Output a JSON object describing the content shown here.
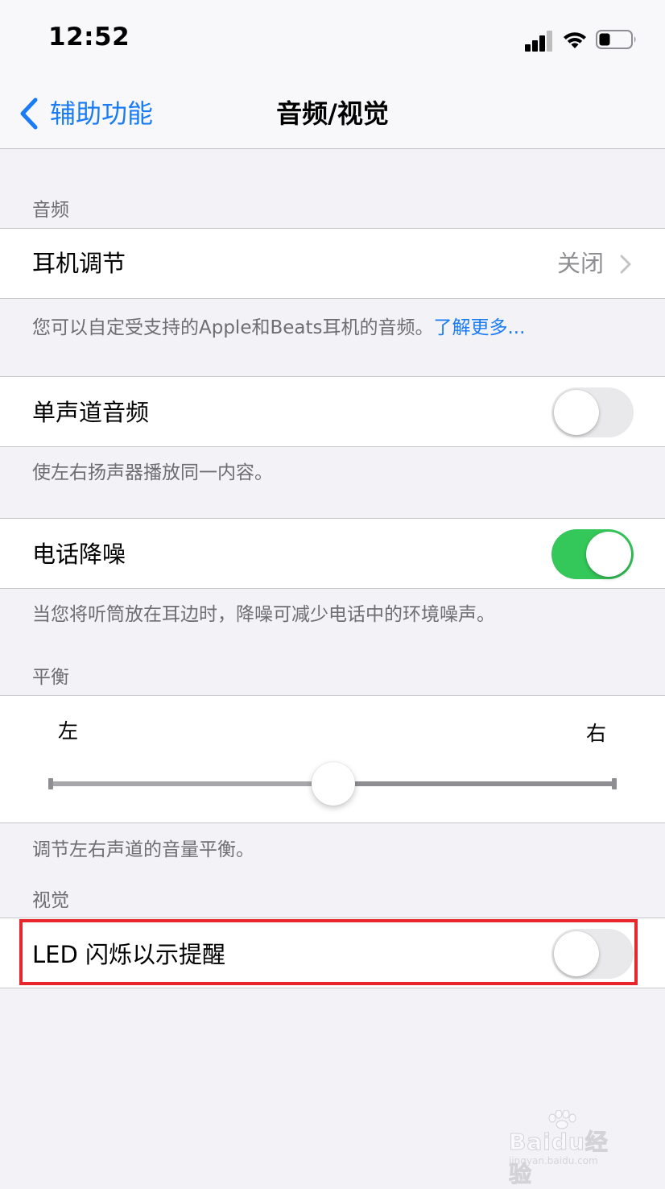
{
  "status_bar": {
    "time": "12:52"
  },
  "nav": {
    "back_label": "辅助功能",
    "title": "音频/视觉"
  },
  "audio_section": {
    "header": "音频",
    "headphone": {
      "label": "耳机调节",
      "value": "关闭"
    },
    "headphone_footer": "您可以自定受支持的Apple和Beats耳机的音频。",
    "headphone_footer_link": "了解更多...",
    "mono_audio": {
      "label": "单声道音频",
      "enabled": false
    },
    "mono_footer": "使左右扬声器播放同一内容。",
    "noise_cancel": {
      "label": "电话降噪",
      "enabled": true
    },
    "noise_footer": "当您将听筒放在耳边时，降噪可减少电话中的环境噪声。"
  },
  "balance_section": {
    "header": "平衡",
    "left_label": "左",
    "right_label": "右",
    "value": 0.5,
    "footer": "调节左右声道的音量平衡。"
  },
  "visual_section": {
    "header": "视觉",
    "led_flash": {
      "label": "LED 闪烁以示提醒",
      "enabled": false
    }
  },
  "watermark": {
    "brand": "Baidu经验",
    "url": "jingyan.baidu.com"
  },
  "colors": {
    "accent": "#1a7cf5",
    "toggle_on": "#34c759",
    "highlight": "#e8262b"
  }
}
